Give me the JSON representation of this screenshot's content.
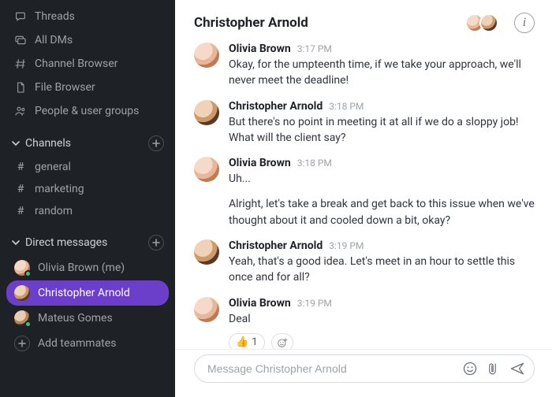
{
  "sidebar": {
    "nav": [
      {
        "label": "Threads",
        "icon": "threads-icon"
      },
      {
        "label": "All DMs",
        "icon": "dms-icon"
      },
      {
        "label": "Channel Browser",
        "icon": "channel-browser-icon"
      },
      {
        "label": "File Browser",
        "icon": "file-browser-icon"
      },
      {
        "label": "People & user groups",
        "icon": "people-icon"
      }
    ],
    "channels_header": "Channels",
    "channels": [
      {
        "name": "general"
      },
      {
        "name": "marketing"
      },
      {
        "name": "random"
      }
    ],
    "dms_header": "Direct messages",
    "dms": [
      {
        "name": "Olivia Brown (me)",
        "avatar": "olivia",
        "online": true,
        "active": false
      },
      {
        "name": "Christopher Arnold",
        "avatar": "chris",
        "online": false,
        "active": true
      },
      {
        "name": "Mateus Gomes",
        "avatar": "mateus",
        "online": true,
        "active": false
      }
    ],
    "add_teammates": "Add teammates"
  },
  "header": {
    "title": "Christopher Arnold"
  },
  "messages": [
    {
      "author": "Olivia Brown",
      "time": "3:17 PM",
      "avatar": "olivia",
      "paragraphs": [
        "Okay, for the umpteenth time, if we take your approach, we'll never meet the deadline!"
      ]
    },
    {
      "author": "Christopher Arnold",
      "time": "3:18 PM",
      "avatar": "chris",
      "paragraphs": [
        "But there's no point in meeting it at all if we do a sloppy job! What will the client say?"
      ]
    },
    {
      "author": "Olivia Brown",
      "time": "3:18 PM",
      "avatar": "olivia",
      "paragraphs": [
        "Uh...",
        "Alright, let's take a break and get back to this issue when we've thought about it and cooled down a bit, okay?"
      ]
    },
    {
      "author": "Christopher Arnold",
      "time": "3:19 PM",
      "avatar": "chris",
      "paragraphs": [
        "Yeah, that's a good idea. Let's meet in an hour to settle this once and for all?"
      ]
    },
    {
      "author": "Olivia Brown",
      "time": "3:19 PM",
      "avatar": "olivia",
      "paragraphs": [
        "Deal"
      ],
      "reactions": [
        {
          "emoji": "👍",
          "count": "1"
        }
      ]
    }
  ],
  "composer": {
    "placeholder": "Message Christopher Arnold"
  }
}
